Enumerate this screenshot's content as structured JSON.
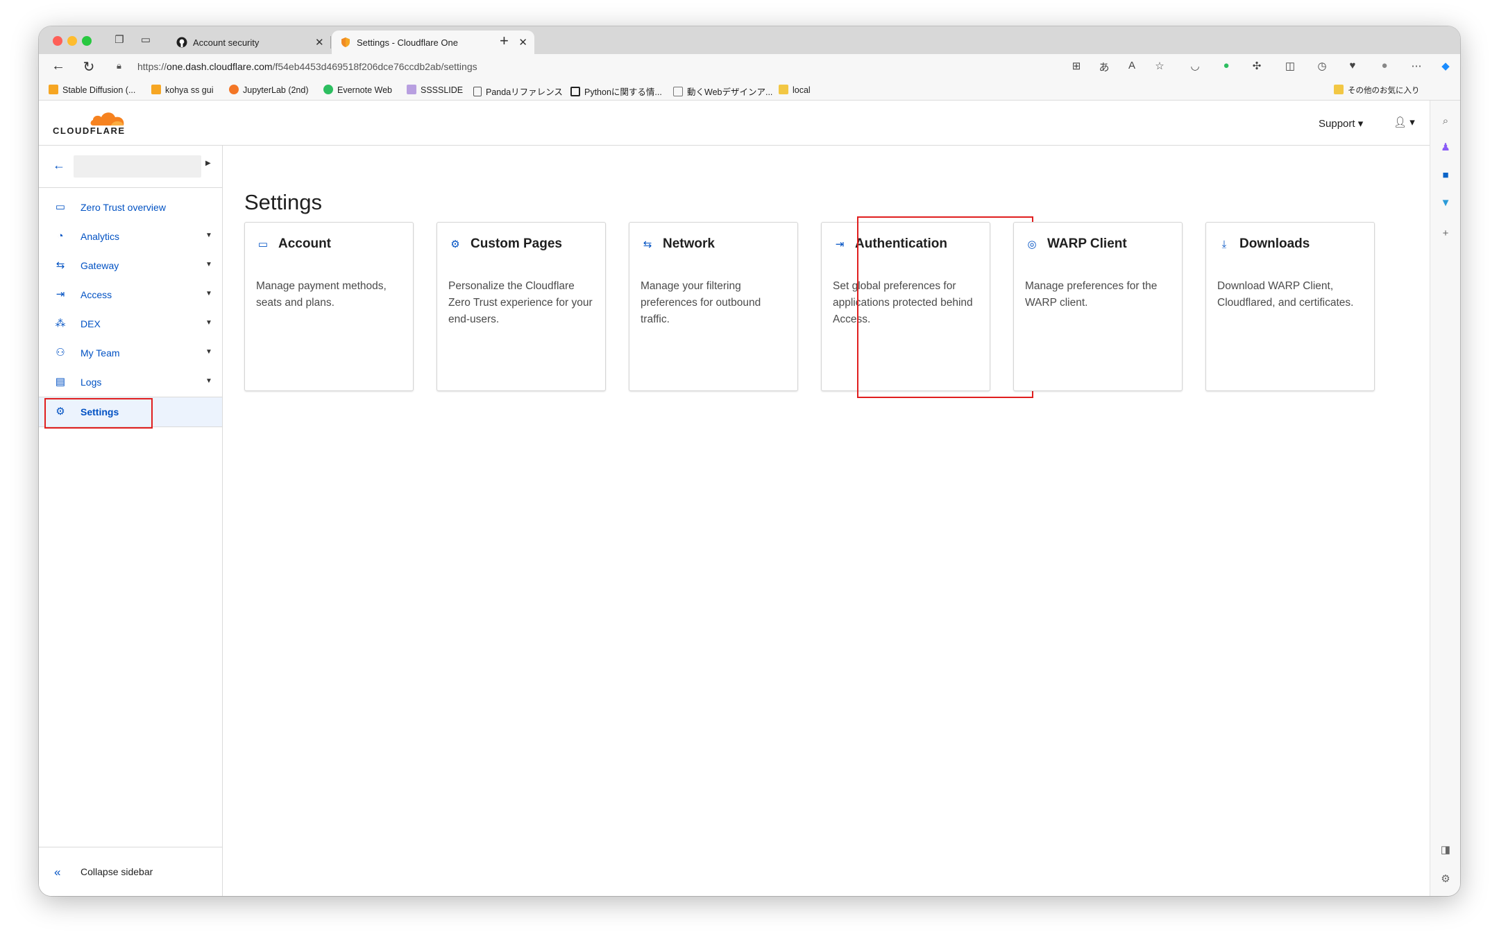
{
  "browser": {
    "tabs": [
      {
        "title": "Account security",
        "active": false
      },
      {
        "title": "Settings - Cloudflare One",
        "active": true
      }
    ],
    "url_prefix": "https://",
    "url_host": "one.dash.cloudflare.com",
    "url_path": "/f54eb4453d469518f206dce76ccdb2ab/settings"
  },
  "bookmarks": [
    {
      "label": "Stable Diffusion (...",
      "color": "#f6a623"
    },
    {
      "label": "kohya ss gui",
      "color": "#f6a623"
    },
    {
      "label": "JupyterLab (2nd)",
      "color": "#f37626"
    },
    {
      "label": "Evernote Web",
      "color": "#2dbe60"
    },
    {
      "label": "SSSSLIDE",
      "color": "#b89fe0"
    },
    {
      "label": "Pandaリファレンス",
      "color": "#888888"
    },
    {
      "label": "Pythonに関する情...",
      "color": "#222222"
    },
    {
      "label": "動くWebデザインア...",
      "color": "#888888"
    },
    {
      "label": "local",
      "color": "#f2c744"
    }
  ],
  "bookmarks_other": "その他のお気に入り",
  "header": {
    "logo_text": "CLOUDFLARE",
    "support_label": "Support"
  },
  "sidebar": {
    "items": [
      {
        "label": "Zero Trust overview",
        "icon": "browser-window-icon",
        "caret": false
      },
      {
        "label": "Analytics",
        "icon": "pie-chart-icon",
        "caret": true
      },
      {
        "label": "Gateway",
        "icon": "gateway-icon",
        "caret": true
      },
      {
        "label": "Access",
        "icon": "access-arrow-icon",
        "caret": true
      },
      {
        "label": "DEX",
        "icon": "dex-network-icon",
        "caret": true
      },
      {
        "label": "My Team",
        "icon": "team-icon",
        "caret": true
      },
      {
        "label": "Logs",
        "icon": "logs-icon",
        "caret": true
      },
      {
        "label": "Settings",
        "icon": "gear-icon",
        "caret": false,
        "active": true
      }
    ],
    "collapse_label": "Collapse sidebar"
  },
  "main": {
    "title": "Settings",
    "cards": [
      {
        "title": "Account",
        "icon": "credit-card-icon",
        "desc": "Manage payment methods, seats and plans."
      },
      {
        "title": "Custom Pages",
        "icon": "gear-icon",
        "desc": "Personalize the Cloudflare Zero Trust experience for your end-users."
      },
      {
        "title": "Network",
        "icon": "network-icon",
        "desc": "Manage your filtering preferences for outbound traffic."
      },
      {
        "title": "Authentication",
        "icon": "login-arrow-icon",
        "desc": "Set global preferences for applications protected behind Access."
      },
      {
        "title": "WARP Client",
        "icon": "warp-icon",
        "desc": "Manage preferences for the WARP client."
      },
      {
        "title": "Downloads",
        "icon": "download-icon",
        "desc": "Download WARP Client, Cloudflared, and certificates."
      }
    ]
  },
  "colors": {
    "accent": "#0051c3",
    "brand_orange": "#f6821f",
    "highlight": "#e01e1e"
  }
}
